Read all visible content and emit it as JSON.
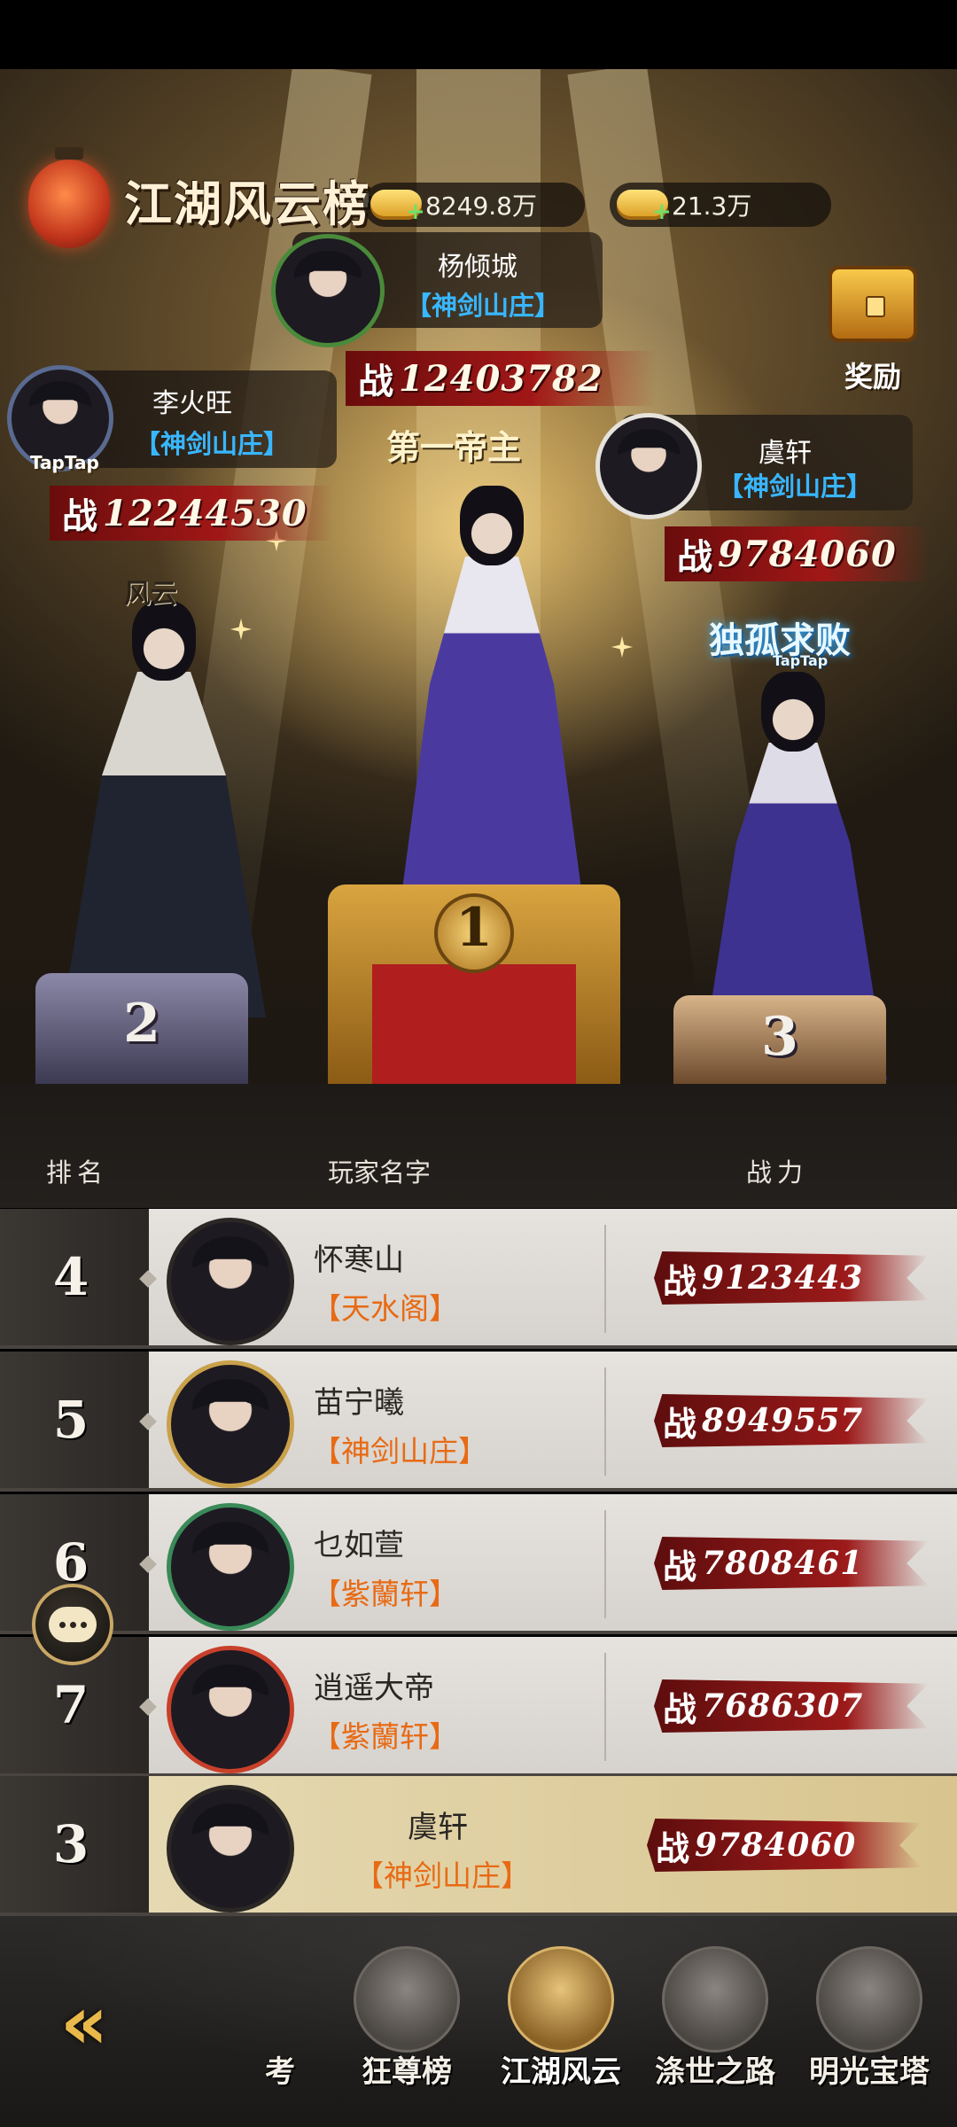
{
  "header": {
    "title": "江湖风云榜",
    "currency": [
      {
        "name": "silver-icon",
        "value": "8249.8万"
      },
      {
        "name": "gold-ingot-icon",
        "value": "21.3万"
      }
    ],
    "reward_label": "奖励"
  },
  "podium": {
    "first": {
      "rank": "1",
      "name": "杨倾城",
      "guild": "【神剑山庄】",
      "power_prefix": "战",
      "power": "12403782",
      "badge": "第一帝主"
    },
    "second": {
      "rank": "2",
      "name": "李火旺",
      "guild": "【神剑山庄】",
      "power_prefix": "战",
      "power": "12244530",
      "avatar_badge": "TapTap",
      "title_badge": "风云"
    },
    "third": {
      "rank": "3",
      "name": "虞轩",
      "guild": "【神剑山庄】",
      "power_prefix": "战",
      "power": "9784060",
      "title_badge": "独孤求败",
      "title_sub": "TapTap"
    }
  },
  "table": {
    "headers": {
      "rank": "排名",
      "player": "玩家名字",
      "power": "战力"
    },
    "rows": [
      {
        "rank": "4",
        "name": "怀寒山",
        "guild": "【天水阁】",
        "power_prefix": "战",
        "power": "9123443"
      },
      {
        "rank": "5",
        "name": "苗宁曦",
        "guild": "【神剑山庄】",
        "power_prefix": "战",
        "power": "8949557"
      },
      {
        "rank": "6",
        "name": "乜如萱",
        "guild": "【紫蘭轩】",
        "power_prefix": "战",
        "power": "7808461"
      },
      {
        "rank": "7",
        "name": "逍遥大帝",
        "guild": "【紫蘭轩】",
        "power_prefix": "战",
        "power": "7686307"
      }
    ],
    "my_row": {
      "rank": "3",
      "name": "虞轩",
      "guild": "【神剑山庄】",
      "power_prefix": "战",
      "power": "9784060"
    }
  },
  "bottom_nav": {
    "items": [
      {
        "label": "狂尊榜",
        "active": false
      },
      {
        "label": "江湖风云",
        "active": true
      },
      {
        "label": "涤世之路",
        "active": false
      },
      {
        "label": "明光宝塔",
        "active": false
      }
    ],
    "partial_label": "考"
  },
  "colors": {
    "guild_blue": "#38b6ff",
    "guild_orange": "#e86a14",
    "power_red": "#9c1a1a"
  }
}
